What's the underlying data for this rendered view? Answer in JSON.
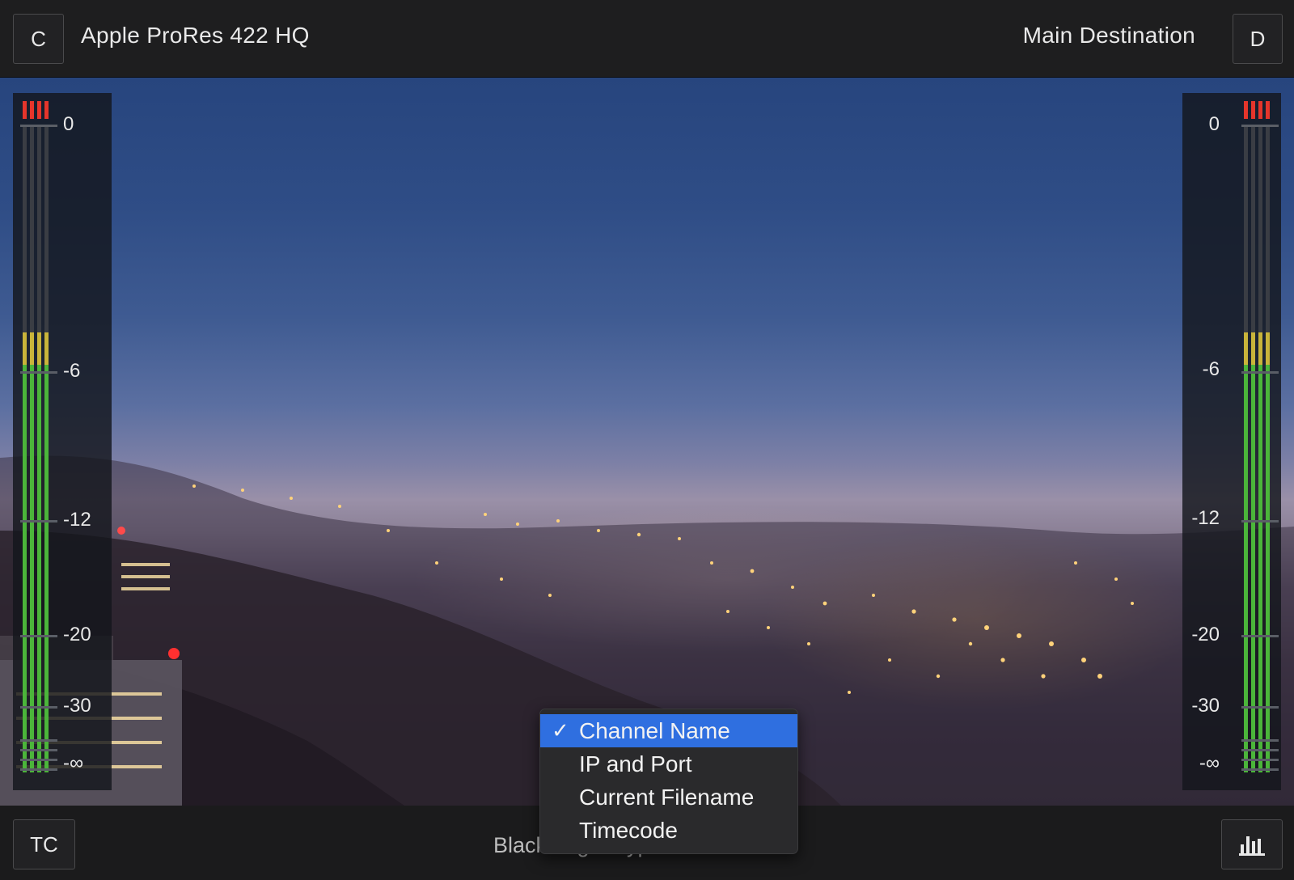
{
  "header": {
    "left_button": "C",
    "codec": "Apple ProRes 422 HQ",
    "destination": "Main Destination",
    "right_button": "D"
  },
  "meters": {
    "scale_labels": [
      "0",
      "-6",
      "-12",
      "-20",
      "-30",
      "-∞"
    ],
    "left_channel_level": 0.68,
    "right_channel_level": 0.68
  },
  "footer": {
    "tc_button": "TC",
    "label": "Blackmagic HyperDeck Studio",
    "histogram_icon": "bar-chart-icon"
  },
  "overlay_menu": {
    "items": [
      {
        "label": "Channel Name",
        "checked": true
      },
      {
        "label": "IP and Port",
        "checked": false
      },
      {
        "label": "Current Filename",
        "checked": false
      },
      {
        "label": "Timecode",
        "checked": false
      }
    ],
    "check_glyph": "✓"
  },
  "colors": {
    "selection": "#2f6fe0",
    "meter_green": "#4bb53a",
    "meter_yellow": "#c9b43a",
    "meter_red": "#e5352b"
  }
}
